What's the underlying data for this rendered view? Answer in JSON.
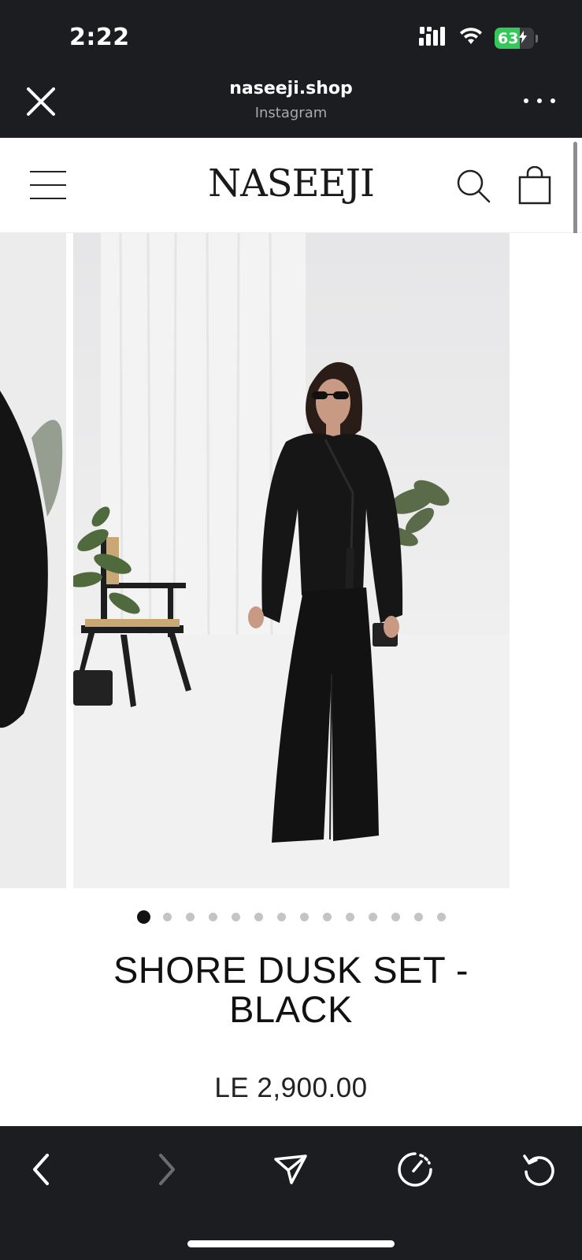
{
  "status_bar": {
    "time": "2:22",
    "battery_percent": "63",
    "battery_level": 0.63,
    "signal_icon": "cellular-signal-icon",
    "wifi_icon": "wifi-icon",
    "charging_icon": "bolt-icon"
  },
  "browser_header": {
    "domain": "naseeji.shop",
    "source": "Instagram",
    "close_icon": "close-icon",
    "more_icon": "more-icon"
  },
  "store_header": {
    "logo": "NASEEJI",
    "menu_icon": "hamburger-menu-icon",
    "search_icon": "search-icon",
    "cart_icon": "shopping-bag-icon"
  },
  "gallery": {
    "slide_count": 14,
    "active_index": 0,
    "zoom_icon": "zoom-icon"
  },
  "product": {
    "title": "SHORE DUSK SET - BLACK",
    "price": "LE 2,900.00"
  },
  "bottom_toolbar": {
    "back_icon": "back-arrow-icon",
    "forward_icon": "forward-arrow-icon",
    "share_icon": "send-icon",
    "speed_icon": "speedometer-icon",
    "reload_icon": "reload-icon"
  },
  "colors": {
    "chrome_background": "#1b1d20",
    "battery_green": "#34c759",
    "page_background": "#ffffff",
    "text_dark": "#111111"
  }
}
